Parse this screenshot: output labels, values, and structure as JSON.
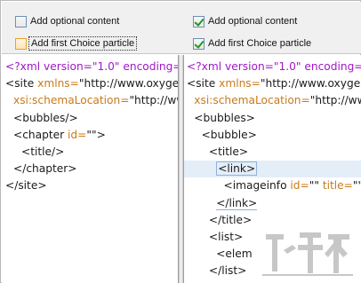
{
  "options": {
    "left": {
      "add_optional_content": {
        "label": "Add optional content",
        "checked": false
      },
      "add_first_choice": {
        "label": "Add first Choice particle",
        "checked": false
      }
    },
    "right": {
      "add_optional_content": {
        "label": "Add optional content",
        "checked": true
      },
      "add_first_choice": {
        "label": "Add first Choice particle",
        "checked": true
      }
    }
  },
  "left_editor": {
    "lines": [
      {
        "indent": 0,
        "parts": [
          {
            "t": "<?xml version=\"1.0\" encoding=\"",
            "c": "pi"
          }
        ]
      },
      {
        "indent": 0,
        "parts": [
          {
            "t": "<site ",
            "c": "tag"
          },
          {
            "t": "xmlns=",
            "c": "attr"
          },
          {
            "t": "\"http://www.oxygen",
            "c": "val"
          }
        ]
      },
      {
        "indent": 1,
        "parts": [
          {
            "t": "xsi:schemaLocation=",
            "c": "attr"
          },
          {
            "t": "\"http://ww",
            "c": "val"
          }
        ]
      },
      {
        "indent": 1,
        "parts": [
          {
            "t": "<bubbles/>",
            "c": "tag"
          }
        ]
      },
      {
        "indent": 1,
        "parts": [
          {
            "t": "<chapter ",
            "c": "tag"
          },
          {
            "t": "id=",
            "c": "attr"
          },
          {
            "t": "\"\">",
            "c": "val"
          }
        ]
      },
      {
        "indent": 2,
        "parts": [
          {
            "t": "<title/>",
            "c": "tag"
          }
        ]
      },
      {
        "indent": 1,
        "parts": [
          {
            "t": "</chapter>",
            "c": "tag"
          }
        ]
      },
      {
        "indent": 0,
        "parts": [
          {
            "t": "</site>",
            "c": "tag"
          }
        ]
      }
    ]
  },
  "right_editor": {
    "lines": [
      {
        "indent": 0,
        "parts": [
          {
            "t": "<?xml version=\"1.0\" encoding=",
            "c": "pi"
          }
        ]
      },
      {
        "indent": 0,
        "parts": [
          {
            "t": "<site ",
            "c": "tag"
          },
          {
            "t": "xmlns=",
            "c": "attr"
          },
          {
            "t": "\"http://www.oxygen",
            "c": "val"
          }
        ]
      },
      {
        "indent": 1,
        "parts": [
          {
            "t": "xsi:schemaLocation=",
            "c": "attr"
          },
          {
            "t": "\"http://ww",
            "c": "val"
          }
        ]
      },
      {
        "indent": 1,
        "parts": [
          {
            "t": "<bubbles>",
            "c": "tag"
          }
        ]
      },
      {
        "indent": 2,
        "parts": [
          {
            "t": "<bubble>",
            "c": "tag"
          }
        ]
      },
      {
        "indent": 3,
        "parts": [
          {
            "t": "<title>",
            "c": "tag"
          }
        ]
      },
      {
        "indent": 4,
        "hl": true,
        "parts": [
          {
            "t": "<link>",
            "c": "tag",
            "box": "boxed"
          }
        ]
      },
      {
        "indent": 5,
        "parts": [
          {
            "t": "<imageinfo ",
            "c": "tag"
          },
          {
            "t": "id=",
            "c": "attr"
          },
          {
            "t": "\"\" ",
            "c": "val"
          },
          {
            "t": "title=",
            "c": "attr"
          },
          {
            "t": "\"\" ",
            "c": "val"
          },
          {
            "t": "s",
            "c": "attr"
          }
        ]
      },
      {
        "indent": 4,
        "parts": [
          {
            "t": "</link>",
            "c": "tag",
            "box": "underl"
          }
        ]
      },
      {
        "indent": 3,
        "parts": [
          {
            "t": "</title>",
            "c": "tag"
          }
        ]
      },
      {
        "indent": 3,
        "parts": [
          {
            "t": "<list>",
            "c": "tag"
          }
        ]
      },
      {
        "indent": 4,
        "parts": [
          {
            "t": "<elem",
            "c": "tag"
          }
        ]
      },
      {
        "indent": 3,
        "parts": [
          {
            "t": "</list>",
            "c": "tag"
          }
        ]
      }
    ]
  },
  "colors": {
    "processing_instruction": "#a018c8",
    "attribute": "#c87a1c",
    "tag": "#1a1a1a",
    "highlight": "#e4eef9"
  },
  "watermark": {
    "icon": "download-site-logo"
  }
}
